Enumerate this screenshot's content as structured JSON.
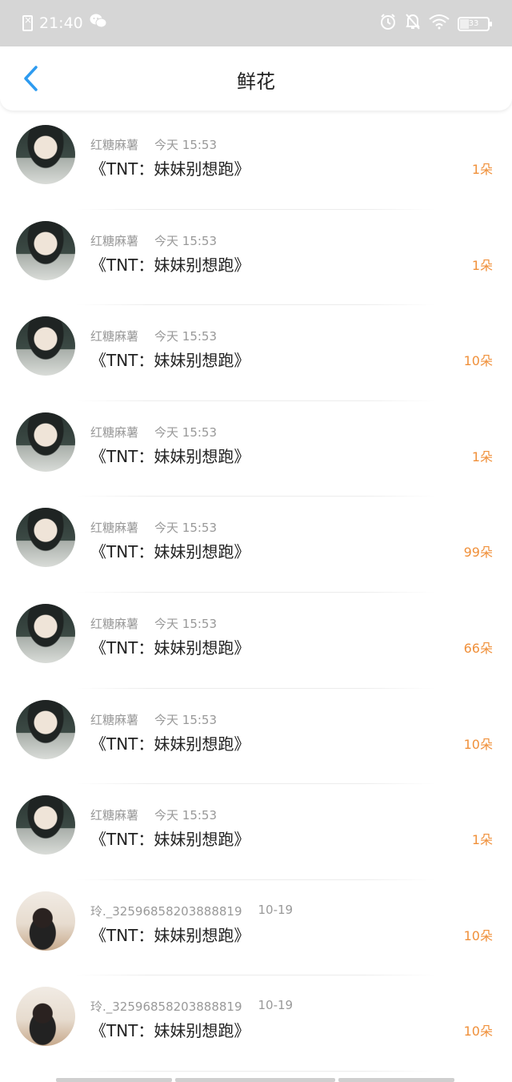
{
  "status_bar": {
    "time": "21:40",
    "battery": "33",
    "battery_level": 0.33,
    "icons": [
      "sim-off-icon",
      "wechat-icon",
      "alarm-icon",
      "do-not-disturb-icon",
      "wifi-icon",
      "battery-icon"
    ]
  },
  "nav": {
    "back_icon": "chevron-left-icon",
    "title": "鲜花"
  },
  "colors": {
    "accent": "#2d9bf0",
    "count": "#f0903a",
    "meta": "#999999",
    "status_bar_bg": "#d6d6d6"
  },
  "items": [
    {
      "name": "红糖麻薯",
      "time": "今天 15:53",
      "message": "《TNT：妹妹别想跑》",
      "count": "1朵",
      "avatar": "a"
    },
    {
      "name": "红糖麻薯",
      "time": "今天 15:53",
      "message": "《TNT：妹妹别想跑》",
      "count": "1朵",
      "avatar": "a"
    },
    {
      "name": "红糖麻薯",
      "time": "今天 15:53",
      "message": "《TNT：妹妹别想跑》",
      "count": "10朵",
      "avatar": "a"
    },
    {
      "name": "红糖麻薯",
      "time": "今天 15:53",
      "message": "《TNT：妹妹别想跑》",
      "count": "1朵",
      "avatar": "a"
    },
    {
      "name": "红糖麻薯",
      "time": "今天 15:53",
      "message": "《TNT：妹妹别想跑》",
      "count": "99朵",
      "avatar": "a"
    },
    {
      "name": "红糖麻薯",
      "time": "今天 15:53",
      "message": "《TNT：妹妹别想跑》",
      "count": "66朵",
      "avatar": "a"
    },
    {
      "name": "红糖麻薯",
      "time": "今天 15:53",
      "message": "《TNT：妹妹别想跑》",
      "count": "10朵",
      "avatar": "a"
    },
    {
      "name": "红糖麻薯",
      "time": "今天 15:53",
      "message": "《TNT：妹妹别想跑》",
      "count": "1朵",
      "avatar": "a"
    },
    {
      "name": "玲._32596858203888819",
      "time": "10-19",
      "message": "《TNT：妹妹别想跑》",
      "count": "10朵",
      "avatar": "b"
    },
    {
      "name": "玲._32596858203888819",
      "time": "10-19",
      "message": "《TNT：妹妹别想跑》",
      "count": "10朵",
      "avatar": "b"
    }
  ]
}
